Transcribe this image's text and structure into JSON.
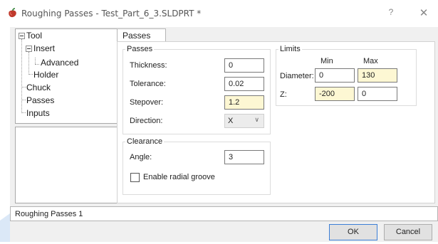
{
  "window": {
    "title": "Roughing Passes - Test_Part_6_3.SLDPRT *",
    "help_label": "?",
    "close_label": "✕",
    "icon": "pepper-app-icon"
  },
  "tree": {
    "items": [
      {
        "label": "Tool"
      },
      {
        "label": "Insert"
      },
      {
        "label": "Advanced"
      },
      {
        "label": "Holder"
      },
      {
        "label": "Chuck"
      },
      {
        "label": "Passes"
      },
      {
        "label": "Inputs"
      }
    ]
  },
  "tab": {
    "label": "Passes"
  },
  "passes": {
    "title": "Passes",
    "thickness": {
      "label": "Thickness:",
      "value": "0"
    },
    "tolerance": {
      "label": "Tolerance:",
      "value": "0.02"
    },
    "stepover": {
      "label": "Stepover:",
      "value": "1.2"
    },
    "direction": {
      "label": "Direction:",
      "value": "X"
    }
  },
  "clearance": {
    "title": "Clearance",
    "angle": {
      "label": "Angle:",
      "value": "3"
    },
    "radial_groove": {
      "label": "Enable radial groove",
      "checked": false
    }
  },
  "limits": {
    "title": "Limits",
    "min_header": "Min",
    "max_header": "Max",
    "diameter": {
      "label": "Diameter:",
      "min": "0",
      "max": "130"
    },
    "z": {
      "label": "Z:",
      "min": "-200",
      "max": "0"
    }
  },
  "status": {
    "text": "Roughing Passes 1"
  },
  "buttons": {
    "ok": "OK",
    "cancel": "Cancel"
  },
  "colors": {
    "dialog_bg": "#f0f0f0",
    "highlight_field": "#fdf7d3",
    "default_button_border": "#3c7fd6"
  }
}
